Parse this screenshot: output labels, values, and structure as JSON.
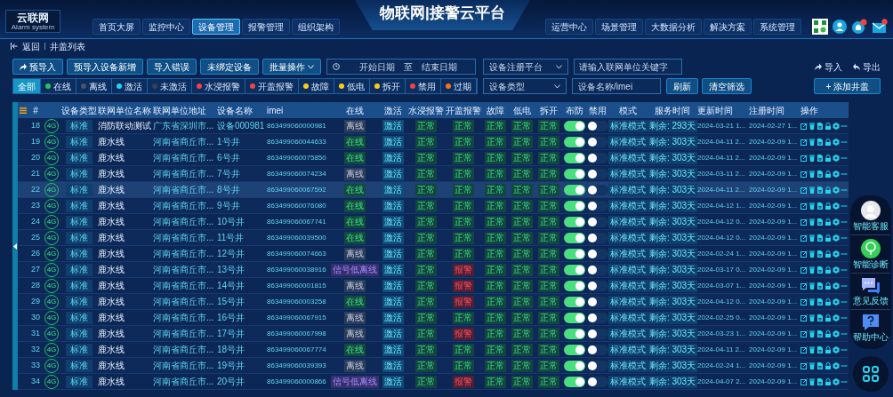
{
  "header": {
    "logo": {
      "name": "云联网",
      "subtitle": "Alarm system"
    },
    "title": "物联网|接警云平台",
    "nav_left": [
      {
        "label": "首页大屏",
        "selected": false
      },
      {
        "label": "监控中心",
        "selected": false
      },
      {
        "label": "设备管理",
        "selected": true
      },
      {
        "label": "报警管理",
        "selected": false
      },
      {
        "label": "组织架构",
        "selected": false
      }
    ],
    "nav_right": [
      {
        "label": "运营中心",
        "selected": false
      },
      {
        "label": "场景管理",
        "selected": false
      },
      {
        "label": "大数据分析",
        "selected": false
      },
      {
        "label": "解决方案",
        "selected": false
      },
      {
        "label": "系统管理",
        "selected": false
      }
    ]
  },
  "breadcrumb": {
    "back": "返回",
    "current": "井盖列表"
  },
  "toolbar": {
    "buttons": [
      "预导入",
      "预导入设备新增",
      "导入错误",
      "未绑定设备"
    ],
    "batch": "批量操作",
    "date_start": "开始日期",
    "date_separator": "至",
    "date_end": "结束日期",
    "platform_select": "设备注册平台",
    "unit_search": {
      "placeholder": "请输入联网单位关键字"
    },
    "import": "导入",
    "export": "导出"
  },
  "filters": [
    {
      "label": "全部",
      "selected": true
    },
    {
      "label": "在线",
      "selected": false,
      "color": "#22c55e"
    },
    {
      "label": "离线",
      "selected": false,
      "color": "#4b5563"
    },
    {
      "label": "激活",
      "selected": false,
      "color": "#22d3ee"
    },
    {
      "label": "未激活",
      "selected": false,
      "color": "#374151"
    },
    {
      "label": "水浸报警",
      "selected": false,
      "color": "#ef4444"
    },
    {
      "label": "开盖报警",
      "selected": false,
      "color": "#ef4444"
    },
    {
      "label": "故障",
      "selected": false,
      "color": "#facc15"
    },
    {
      "label": "低电",
      "selected": false,
      "color": "#facc15"
    },
    {
      "label": "拆开",
      "selected": false,
      "color": "#facc15"
    },
    {
      "label": "禁用",
      "selected": false,
      "color": "#ef4444"
    },
    {
      "label": "过期",
      "selected": false,
      "color": "#f97316"
    }
  ],
  "filter_bar": {
    "type_select": "设备类型",
    "name_search": {
      "placeholder": "设备名称/imei"
    },
    "refresh": "刷新",
    "clear": "清空筛选",
    "add": "+ 添加井盖"
  },
  "table": {
    "columns": [
      "#",
      "设备类型",
      "联网单位名称",
      "联网单位地址",
      "设备名称",
      "imei",
      "在线",
      "激活",
      "水浸报警",
      "开盖报警",
      "故障",
      "低电",
      "拆开",
      "布防",
      "禁用",
      "模式",
      "服务时间",
      "更新时间",
      "注册时间",
      "操作"
    ],
    "rows": [
      {
        "index": "18",
        "network": "4G",
        "type": "标准",
        "unit": "消防联动测试",
        "address": "广东省深圳市...",
        "device": "设备000981",
        "imei": "863499060000981",
        "online": {
          "text": "离线",
          "kind": "offline"
        },
        "activation": "激活",
        "water": {
          "text": "正常",
          "kind": "normal"
        },
        "cover": {
          "text": "正常",
          "kind": "normal"
        },
        "fault": {
          "text": "正常",
          "kind": "normal"
        },
        "low_battery": {
          "text": "正常",
          "kind": "normal"
        },
        "tamper": {
          "text": "正常",
          "kind": "normal"
        },
        "armed": true,
        "disabled": false,
        "mode": "标准模式",
        "service": "剩余: 293天",
        "updated": "2024-03-21 1...",
        "registered": "2024-02-27 1...",
        "selected": false
      },
      {
        "index": "19",
        "network": "4G",
        "type": "标准",
        "unit": "鹿水线",
        "address": "河南省商丘市...",
        "device": "1号井",
        "imei": "863499060044633",
        "online": {
          "text": "在线",
          "kind": "online"
        },
        "activation": "激活",
        "water": {
          "text": "正常",
          "kind": "normal"
        },
        "cover": {
          "text": "正常",
          "kind": "normal"
        },
        "fault": {
          "text": "正常",
          "kind": "normal"
        },
        "low_battery": {
          "text": "正常",
          "kind": "normal"
        },
        "tamper": {
          "text": "正常",
          "kind": "normal"
        },
        "armed": true,
        "disabled": false,
        "mode": "标准模式",
        "service": "剩余: 303天",
        "updated": "2024-04-11 2...",
        "registered": "2024-02-09 1...",
        "selected": false
      },
      {
        "index": "20",
        "network": "4G",
        "type": "标准",
        "unit": "鹿水线",
        "address": "河南省商丘市...",
        "device": "6号井",
        "imei": "863499060075850",
        "online": {
          "text": "在线",
          "kind": "online"
        },
        "activation": "激活",
        "water": {
          "text": "正常",
          "kind": "normal"
        },
        "cover": {
          "text": "正常",
          "kind": "normal"
        },
        "fault": {
          "text": "正常",
          "kind": "normal"
        },
        "low_battery": {
          "text": "正常",
          "kind": "normal"
        },
        "tamper": {
          "text": "正常",
          "kind": "normal"
        },
        "armed": true,
        "disabled": false,
        "mode": "标准模式",
        "service": "剩余: 303天",
        "updated": "2024-04-11 2...",
        "registered": "2024-02-09 1...",
        "selected": false
      },
      {
        "index": "21",
        "network": "4G",
        "type": "标准",
        "unit": "鹿水线",
        "address": "河南省商丘市...",
        "device": "7号井",
        "imei": "863499060074234",
        "online": {
          "text": "离线",
          "kind": "offline"
        },
        "activation": "激活",
        "water": {
          "text": "正常",
          "kind": "normal"
        },
        "cover": {
          "text": "正常",
          "kind": "normal"
        },
        "fault": {
          "text": "正常",
          "kind": "normal"
        },
        "low_battery": {
          "text": "正常",
          "kind": "normal"
        },
        "tamper": {
          "text": "正常",
          "kind": "normal"
        },
        "armed": true,
        "disabled": false,
        "mode": "标准模式",
        "service": "剩余: 303天",
        "updated": "2024-03-11 2...",
        "registered": "2024-02-09 1...",
        "selected": false
      },
      {
        "index": "22",
        "network": "4G",
        "type": "标准",
        "unit": "鹿水线",
        "address": "河南省商丘市...",
        "device": "8号井",
        "imei": "863499060067592",
        "online": {
          "text": "在线",
          "kind": "online"
        },
        "activation": "激活",
        "water": {
          "text": "正常",
          "kind": "normal"
        },
        "cover": {
          "text": "正常",
          "kind": "normal"
        },
        "fault": {
          "text": "正常",
          "kind": "normal"
        },
        "low_battery": {
          "text": "正常",
          "kind": "normal"
        },
        "tamper": {
          "text": "正常",
          "kind": "normal"
        },
        "armed": true,
        "disabled": false,
        "mode": "标准模式",
        "service": "剩余: 303天",
        "updated": "2024-04-11 2...",
        "registered": "2024-02-09 1...",
        "selected": true
      },
      {
        "index": "23",
        "network": "4G",
        "type": "标准",
        "unit": "鹿水线",
        "address": "河南省商丘市...",
        "device": "9号井",
        "imei": "863499060076080",
        "online": {
          "text": "在线",
          "kind": "online"
        },
        "activation": "激活",
        "water": {
          "text": "正常",
          "kind": "normal"
        },
        "cover": {
          "text": "正常",
          "kind": "normal"
        },
        "fault": {
          "text": "正常",
          "kind": "normal"
        },
        "low_battery": {
          "text": "正常",
          "kind": "normal"
        },
        "tamper": {
          "text": "正常",
          "kind": "normal"
        },
        "armed": true,
        "disabled": false,
        "mode": "标准模式",
        "service": "剩余: 303天",
        "updated": "2024-04-12 1...",
        "registered": "2024-02-09 1...",
        "selected": false
      },
      {
        "index": "24",
        "network": "4G",
        "type": "标准",
        "unit": "鹿水线",
        "address": "河南省商丘市...",
        "device": "10号井",
        "imei": "863499060067741",
        "online": {
          "text": "在线",
          "kind": "online"
        },
        "activation": "激活",
        "water": {
          "text": "正常",
          "kind": "normal"
        },
        "cover": {
          "text": "正常",
          "kind": "normal"
        },
        "fault": {
          "text": "正常",
          "kind": "normal"
        },
        "low_battery": {
          "text": "正常",
          "kind": "normal"
        },
        "tamper": {
          "text": "正常",
          "kind": "normal"
        },
        "armed": true,
        "disabled": false,
        "mode": "标准模式",
        "service": "剩余: 303天",
        "updated": "2024-04-12 0...",
        "registered": "2024-02-09 1...",
        "selected": false
      },
      {
        "index": "25",
        "network": "4G",
        "type": "标准",
        "unit": "鹿水线",
        "address": "河南省商丘市...",
        "device": "11号井",
        "imei": "863499060039500",
        "online": {
          "text": "在线",
          "kind": "online"
        },
        "activation": "激活",
        "water": {
          "text": "正常",
          "kind": "normal"
        },
        "cover": {
          "text": "正常",
          "kind": "normal"
        },
        "fault": {
          "text": "正常",
          "kind": "normal"
        },
        "low_battery": {
          "text": "正常",
          "kind": "normal"
        },
        "tamper": {
          "text": "正常",
          "kind": "normal"
        },
        "armed": true,
        "disabled": false,
        "mode": "标准模式",
        "service": "剩余: 303天",
        "updated": "2024-04-12 0...",
        "registered": "2024-02-09 1...",
        "selected": false
      },
      {
        "index": "26",
        "network": "4G",
        "type": "标准",
        "unit": "鹿水线",
        "address": "河南省商丘市...",
        "device": "12号井",
        "imei": "863499060074663",
        "online": {
          "text": "离线",
          "kind": "offline"
        },
        "activation": "激活",
        "water": {
          "text": "正常",
          "kind": "normal"
        },
        "cover": {
          "text": "正常",
          "kind": "normal"
        },
        "fault": {
          "text": "正常",
          "kind": "normal"
        },
        "low_battery": {
          "text": "正常",
          "kind": "normal"
        },
        "tamper": {
          "text": "正常",
          "kind": "normal"
        },
        "armed": true,
        "disabled": false,
        "mode": "标准模式",
        "service": "剩余: 303天",
        "updated": "2024-02-24 1...",
        "registered": "2024-02-09 1...",
        "selected": false
      },
      {
        "index": "27",
        "network": "4G",
        "type": "标准",
        "unit": "鹿水线",
        "address": "河南省商丘市...",
        "device": "13号井",
        "imei": "863499060038916",
        "online": {
          "text": "信号低离线",
          "kind": "weak"
        },
        "activation": "激活",
        "water": {
          "text": "正常",
          "kind": "normal"
        },
        "cover": {
          "text": "报警",
          "kind": "alarm"
        },
        "fault": {
          "text": "正常",
          "kind": "normal"
        },
        "low_battery": {
          "text": "正常",
          "kind": "normal"
        },
        "tamper": {
          "text": "正常",
          "kind": "normal"
        },
        "armed": true,
        "disabled": false,
        "mode": "标准模式",
        "service": "剩余: 303天",
        "updated": "2024-03-17 0...",
        "registered": "2024-02-09 1...",
        "selected": false
      },
      {
        "index": "28",
        "network": "4G",
        "type": "标准",
        "unit": "鹿水线",
        "address": "河南省商丘市...",
        "device": "14号井",
        "imei": "863499060001815",
        "online": {
          "text": "离线",
          "kind": "offline"
        },
        "activation": "激活",
        "water": {
          "text": "正常",
          "kind": "normal"
        },
        "cover": {
          "text": "报警",
          "kind": "alarm"
        },
        "fault": {
          "text": "正常",
          "kind": "normal"
        },
        "low_battery": {
          "text": "正常",
          "kind": "normal"
        },
        "tamper": {
          "text": "正常",
          "kind": "normal"
        },
        "armed": true,
        "disabled": false,
        "mode": "标准模式",
        "service": "剩余: 303天",
        "updated": "2024-03-07 1...",
        "registered": "2024-02-09 1...",
        "selected": false
      },
      {
        "index": "29",
        "network": "4G",
        "type": "标准",
        "unit": "鹿水线",
        "address": "河南省商丘市...",
        "device": "15号井",
        "imei": "863499060003258",
        "online": {
          "text": "在线",
          "kind": "online"
        },
        "activation": "激活",
        "water": {
          "text": "正常",
          "kind": "normal"
        },
        "cover": {
          "text": "报警",
          "kind": "alarm"
        },
        "fault": {
          "text": "正常",
          "kind": "normal"
        },
        "low_battery": {
          "text": "正常",
          "kind": "normal"
        },
        "tamper": {
          "text": "正常",
          "kind": "normal"
        },
        "armed": true,
        "disabled": false,
        "mode": "标准模式",
        "service": "剩余: 303天",
        "updated": "2024-04-12 0...",
        "registered": "2024-02-09 1...",
        "selected": false
      },
      {
        "index": "30",
        "network": "4G",
        "type": "标准",
        "unit": "鹿水线",
        "address": "河南省商丘市...",
        "device": "16号井",
        "imei": "863499060067915",
        "online": {
          "text": "离线",
          "kind": "offline"
        },
        "activation": "激活",
        "water": {
          "text": "正常",
          "kind": "normal"
        },
        "cover": {
          "text": "正常",
          "kind": "normal"
        },
        "fault": {
          "text": "正常",
          "kind": "normal"
        },
        "low_battery": {
          "text": "正常",
          "kind": "normal"
        },
        "tamper": {
          "text": "正常",
          "kind": "normal"
        },
        "armed": true,
        "disabled": false,
        "mode": "标准模式",
        "service": "剩余: 303天",
        "updated": "2024-02-25 0...",
        "registered": "2024-02-09 1...",
        "selected": false
      },
      {
        "index": "31",
        "network": "4G",
        "type": "标准",
        "unit": "鹿水线",
        "address": "河南省商丘市...",
        "device": "17号井",
        "imei": "863499060067998",
        "online": {
          "text": "离线",
          "kind": "offline"
        },
        "activation": "激活",
        "water": {
          "text": "正常",
          "kind": "normal"
        },
        "cover": {
          "text": "报警",
          "kind": "alarm"
        },
        "fault": {
          "text": "正常",
          "kind": "normal"
        },
        "low_battery": {
          "text": "正常",
          "kind": "normal"
        },
        "tamper": {
          "text": "正常",
          "kind": "normal"
        },
        "armed": true,
        "disabled": false,
        "mode": "标准模式",
        "service": "剩余: 303天",
        "updated": "2024-03-23 1...",
        "registered": "2024-02-09 1...",
        "selected": false
      },
      {
        "index": "32",
        "network": "4G",
        "type": "标准",
        "unit": "鹿水线",
        "address": "河南省商丘市...",
        "device": "18号井",
        "imei": "863499060067774",
        "online": {
          "text": "在线",
          "kind": "online"
        },
        "activation": "激活",
        "water": {
          "text": "正常",
          "kind": "normal"
        },
        "cover": {
          "text": "正常",
          "kind": "normal"
        },
        "fault": {
          "text": "正常",
          "kind": "normal"
        },
        "low_battery": {
          "text": "正常",
          "kind": "normal"
        },
        "tamper": {
          "text": "正常",
          "kind": "normal"
        },
        "armed": true,
        "disabled": false,
        "mode": "标准模式",
        "service": "剩余: 303天",
        "updated": "2024-04-11 2...",
        "registered": "2024-02-09 1...",
        "selected": false
      },
      {
        "index": "33",
        "network": "4G",
        "type": "标准",
        "unit": "鹿水线",
        "address": "河南省商丘市...",
        "device": "19号井",
        "imei": "863499060039393",
        "online": {
          "text": "离线",
          "kind": "offline"
        },
        "activation": "激活",
        "water": {
          "text": "正常",
          "kind": "normal"
        },
        "cover": {
          "text": "正常",
          "kind": "normal"
        },
        "fault": {
          "text": "正常",
          "kind": "normal"
        },
        "low_battery": {
          "text": "正常",
          "kind": "normal"
        },
        "tamper": {
          "text": "正常",
          "kind": "normal"
        },
        "armed": true,
        "disabled": false,
        "mode": "标准模式",
        "service": "剩余: 303天",
        "updated": "2024-02-24 1...",
        "registered": "2024-02-09 1...",
        "selected": false
      },
      {
        "index": "34",
        "network": "4G",
        "type": "标准",
        "unit": "鹿水线",
        "address": "河南省商丘市...",
        "device": "20号井",
        "imei": "863499060000866",
        "online": {
          "text": "信号低离线",
          "kind": "weak"
        },
        "activation": "激活",
        "water": {
          "text": "正常",
          "kind": "normal"
        },
        "cover": {
          "text": "报警",
          "kind": "alarm"
        },
        "fault": {
          "text": "正常",
          "kind": "normal"
        },
        "low_battery": {
          "text": "正常",
          "kind": "normal"
        },
        "tamper": {
          "text": "正常",
          "kind": "normal"
        },
        "armed": true,
        "disabled": false,
        "mode": "标准模式",
        "service": "剩余: 303天",
        "updated": "2024-04-07 2...",
        "registered": "2024-02-09 1...",
        "selected": false
      }
    ]
  },
  "assistant": [
    {
      "label": "智能客服",
      "kind": "avatar"
    },
    {
      "label": "智能诊断",
      "kind": "diagnosis"
    },
    {
      "label": "意见反馈",
      "kind": "feedback"
    },
    {
      "label": "帮助中心",
      "kind": "help"
    }
  ]
}
